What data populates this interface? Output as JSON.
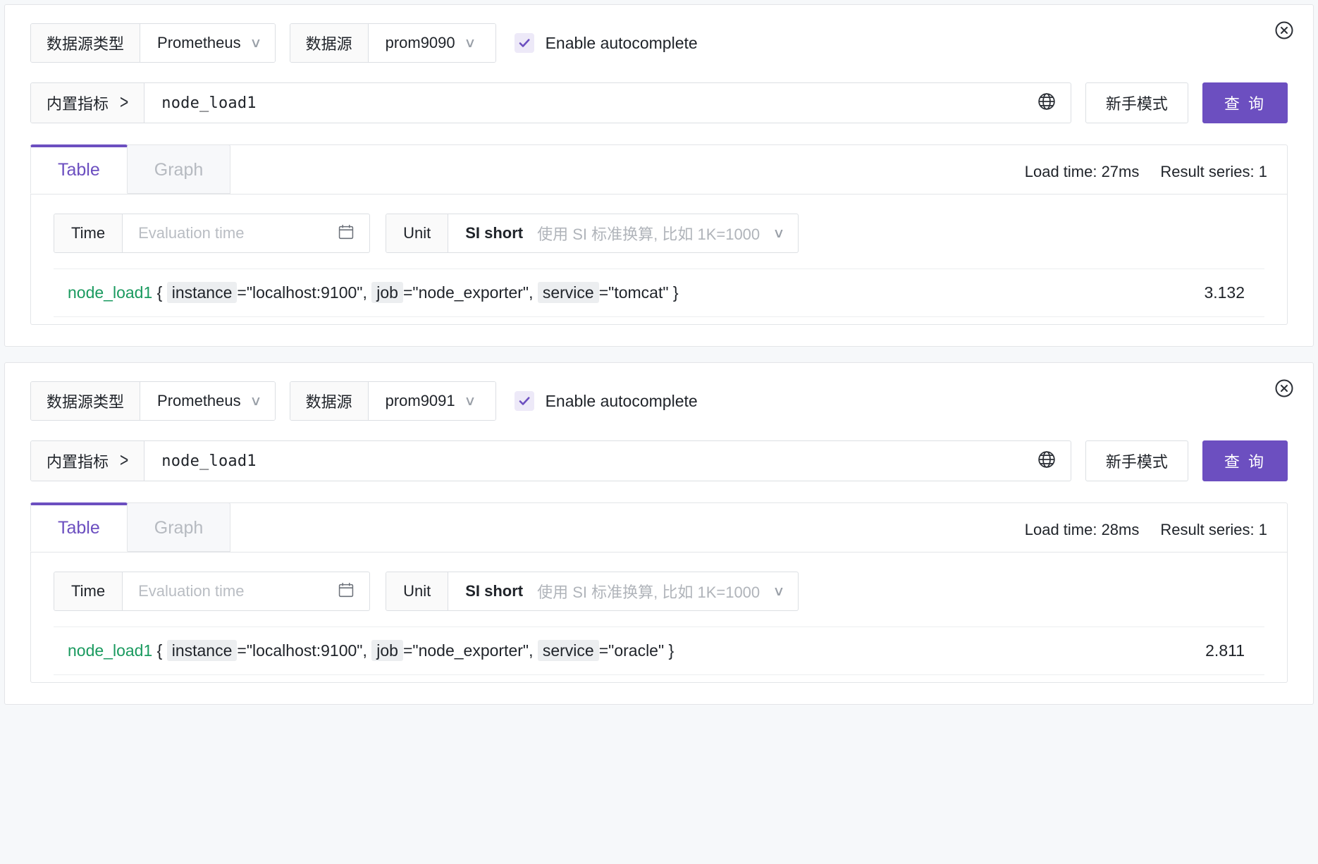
{
  "panels": [
    {
      "close_icon": "close-circle-icon",
      "datasource_type": {
        "label": "数据源类型",
        "value": "Prometheus"
      },
      "datasource": {
        "label": "数据源",
        "value": "prom9090"
      },
      "autocomplete": {
        "label": "Enable autocomplete",
        "checked": true
      },
      "metric_button": {
        "label": "内置指标",
        "arrow": "›"
      },
      "query": {
        "value": "node_load1",
        "globe_icon": "globe-icon"
      },
      "beginner_mode": "新手模式",
      "run_query": "查 询",
      "tabs": [
        {
          "label": "Table",
          "active": true
        },
        {
          "label": "Graph",
          "active": false
        }
      ],
      "meta": {
        "load_time": "Load time: 27ms",
        "result_series": "Result series: 1"
      },
      "time": {
        "label": "Time",
        "placeholder": "Evaluation time",
        "value": "",
        "icon": "calendar-icon"
      },
      "unit": {
        "label": "Unit",
        "value": "SI short",
        "hint": "使用 SI 标准换算, 比如 1K=1000"
      },
      "result": {
        "metric": "node_load1",
        "open_brace": "{",
        "labels": [
          {
            "name": "instance",
            "eq": "=",
            "value": "\"localhost:9100\"",
            "sep": ","
          },
          {
            "name": "job",
            "eq": "=",
            "value": "\"node_exporter\"",
            "sep": ","
          },
          {
            "name": "service",
            "eq": "=",
            "value": "\"tomcat\"",
            "sep": ""
          }
        ],
        "close_brace": "}",
        "value": "3.132"
      }
    },
    {
      "close_icon": "close-circle-icon",
      "datasource_type": {
        "label": "数据源类型",
        "value": "Prometheus"
      },
      "datasource": {
        "label": "数据源",
        "value": "prom9091"
      },
      "autocomplete": {
        "label": "Enable autocomplete",
        "checked": true
      },
      "metric_button": {
        "label": "内置指标",
        "arrow": "›"
      },
      "query": {
        "value": "node_load1",
        "globe_icon": "globe-icon"
      },
      "beginner_mode": "新手模式",
      "run_query": "查 询",
      "tabs": [
        {
          "label": "Table",
          "active": true
        },
        {
          "label": "Graph",
          "active": false
        }
      ],
      "meta": {
        "load_time": "Load time: 28ms",
        "result_series": "Result series: 1"
      },
      "time": {
        "label": "Time",
        "placeholder": "Evaluation time",
        "value": "",
        "icon": "calendar-icon"
      },
      "unit": {
        "label": "Unit",
        "value": "SI short",
        "hint": "使用 SI 标准换算, 比如 1K=1000"
      },
      "result": {
        "metric": "node_load1",
        "open_brace": "{",
        "labels": [
          {
            "name": "instance",
            "eq": "=",
            "value": "\"localhost:9100\"",
            "sep": ","
          },
          {
            "name": "job",
            "eq": "=",
            "value": "\"node_exporter\"",
            "sep": ","
          },
          {
            "name": "service",
            "eq": "=",
            "value": "\"oracle\"",
            "sep": ""
          }
        ],
        "close_brace": "}",
        "value": "2.811"
      }
    }
  ],
  "colors": {
    "accent": "#6c4fc0",
    "metric_green": "#1a9a5f",
    "page_bg": "#f6f8fa",
    "muted": "#b6bac0"
  }
}
